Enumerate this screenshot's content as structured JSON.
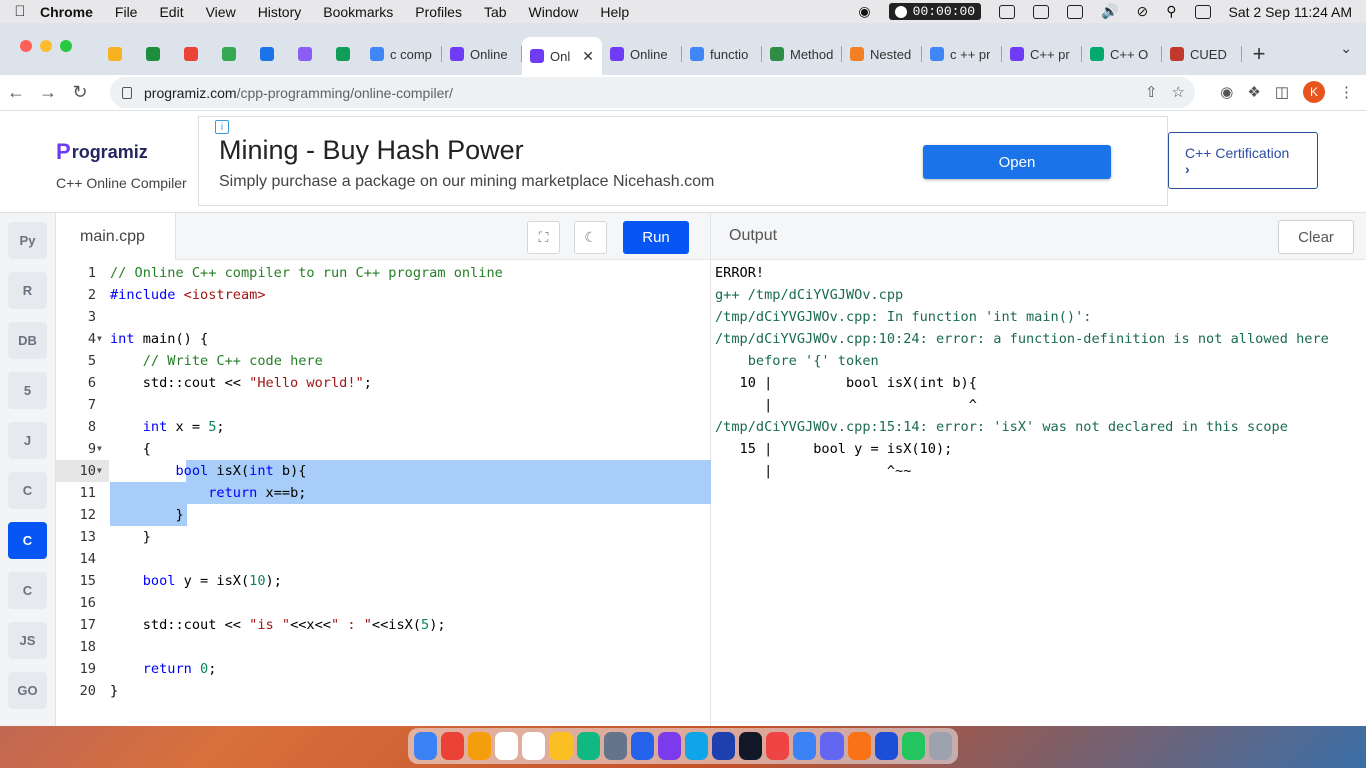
{
  "menubar": {
    "app": "Chrome",
    "items": [
      "File",
      "Edit",
      "View",
      "History",
      "Bookmarks",
      "Profiles",
      "Tab",
      "Window",
      "Help"
    ],
    "timer": "00:00:00",
    "datetime": "Sat 2 Sep  11:24 AM"
  },
  "browser": {
    "tabs": [
      {
        "label": "",
        "favicon_color": "#f6b221",
        "pinned": true
      },
      {
        "label": "",
        "favicon_color": "#1e8e3e",
        "pinned": true
      },
      {
        "label": "",
        "favicon_color": "#ea4335",
        "pinned": true
      },
      {
        "label": "",
        "favicon_color": "#34a853",
        "pinned": true
      },
      {
        "label": "",
        "favicon_color": "#1a73e8",
        "pinned": true
      },
      {
        "label": "",
        "favicon_color": "#8b5cf6",
        "pinned": true
      },
      {
        "label": "",
        "favicon_color": "#0f9d58",
        "pinned": true
      },
      {
        "label": "c comp",
        "favicon_color": "#4285f4",
        "pinned": false
      },
      {
        "label": "Online",
        "favicon_color": "#6f3cf6",
        "pinned": false
      },
      {
        "label": "Onl",
        "favicon_color": "#6f3cf6",
        "pinned": false,
        "active": true
      },
      {
        "label": "Online",
        "favicon_color": "#6f3cf6",
        "pinned": false
      },
      {
        "label": "functio",
        "favicon_color": "#4285f4",
        "pinned": false
      },
      {
        "label": "Method",
        "favicon_color": "#2f8d46",
        "pinned": false
      },
      {
        "label": "Nested",
        "favicon_color": "#f48024",
        "pinned": false
      },
      {
        "label": "c ++ pr",
        "favicon_color": "#4285f4",
        "pinned": false
      },
      {
        "label": "C++ pr",
        "favicon_color": "#6f3cf6",
        "pinned": false
      },
      {
        "label": "C++ O",
        "favicon_color": "#04aa6d",
        "pinned": false
      },
      {
        "label": "CUED",
        "favicon_color": "#c0392b",
        "pinned": false
      }
    ],
    "url_host": "programiz.com",
    "url_path": "/cpp-programming/online-compiler/",
    "avatar_letter": "K"
  },
  "site": {
    "logo": "rogramiz",
    "logo_p": "P",
    "subtitle": "C++ Online Compiler",
    "ad_title": "Mining - Buy Hash Power",
    "ad_subtitle": "Simply purchase a package on our mining marketplace Nicehash.com",
    "ad_button": "Open",
    "ad_info": "i",
    "cert_label": "C++ Certification",
    "cert_arrow": "›"
  },
  "languages": [
    {
      "name": "python-icon",
      "glyph": "Py"
    },
    {
      "name": "r-icon",
      "glyph": "R"
    },
    {
      "name": "sql-icon",
      "glyph": "DB"
    },
    {
      "name": "html-icon",
      "glyph": "5"
    },
    {
      "name": "java-icon",
      "glyph": "J"
    },
    {
      "name": "c-icon",
      "glyph": "C"
    },
    {
      "name": "cpp-icon",
      "glyph": "C",
      "active": true
    },
    {
      "name": "csharp-icon",
      "glyph": "C"
    },
    {
      "name": "js-icon",
      "glyph": "JS"
    },
    {
      "name": "go-icon",
      "glyph": "GO"
    }
  ],
  "editor": {
    "filename": "main.cpp",
    "run_label": "Run",
    "active_line": 10,
    "lines": [
      "<span class=\"c\">// Online C++ compiler to run C++ program online</span>",
      "<span class=\"k\">#include</span> <span class=\"inc\">&lt;iostream&gt;</span>",
      "",
      "<span class=\"k\">int</span> main() {",
      "    <span class=\"c\">// Write C++ code here</span>",
      "    std::cout &lt;&lt; <span class=\"s\">\"Hello world!\"</span>;",
      "",
      "    <span class=\"k\">int</span> x = <span class=\"n\">5</span>;",
      "    {",
      "        <span class=\"k\">bool</span> isX(<span class=\"k\">int</span> b){",
      "            <span class=\"k\">return</span> x==b;",
      "        }",
      "    }",
      "",
      "    <span class=\"k\">bool</span> y = isX(<span class=\"n\">10</span>);",
      "",
      "    std::cout &lt;&lt; <span class=\"s\">\"is \"</span>&lt;&lt;x&lt;&lt;<span class=\"s\">\" : \"</span>&lt;&lt;isX(<span class=\"n\">5</span>);",
      "",
      "    <span class=\"k\">return</span> <span class=\"n\">0</span>;",
      "}"
    ],
    "folds": [
      4,
      9,
      10
    ]
  },
  "output": {
    "title": "Output",
    "clear_label": "Clear",
    "lines": [
      {
        "text": "ERROR!",
        "cls": "err-head"
      },
      {
        "text": "g++ /tmp/dCiYVGJWOv.cpp",
        "cls": ""
      },
      {
        "text": "/tmp/dCiYVGJWOv.cpp: In function 'int main()':",
        "cls": ""
      },
      {
        "text": "/tmp/dCiYVGJWOv.cpp:10:24: error: a function-definition is not allowed here",
        "cls": ""
      },
      {
        "text": "    before '{' token",
        "cls": ""
      },
      {
        "text": "   10 |         bool isX(int b){",
        "cls": "code-echo"
      },
      {
        "text": "      |                        ^",
        "cls": "code-echo"
      },
      {
        "text": "/tmp/dCiYVGJWOv.cpp:15:14: error: 'isX' was not declared in this scope",
        "cls": ""
      },
      {
        "text": "   15 |     bool y = isX(10);",
        "cls": "code-echo"
      },
      {
        "text": "      |              ^~~",
        "cls": "code-echo"
      }
    ]
  },
  "dock": {
    "apps": [
      "#3b82f6",
      "#ea4335",
      "#f59e0b",
      "#ffffff",
      "#ffffff",
      "#fbbf24",
      "#10b981",
      "#64748b",
      "#2563eb",
      "#7c3aed",
      "#0ea5e9",
      "#1e40af",
      "#111827",
      "#ef4444",
      "#3b82f6",
      "#6366f1",
      "#f97316",
      "#1d4ed8",
      "#22c55e",
      "#9ca3af"
    ]
  }
}
